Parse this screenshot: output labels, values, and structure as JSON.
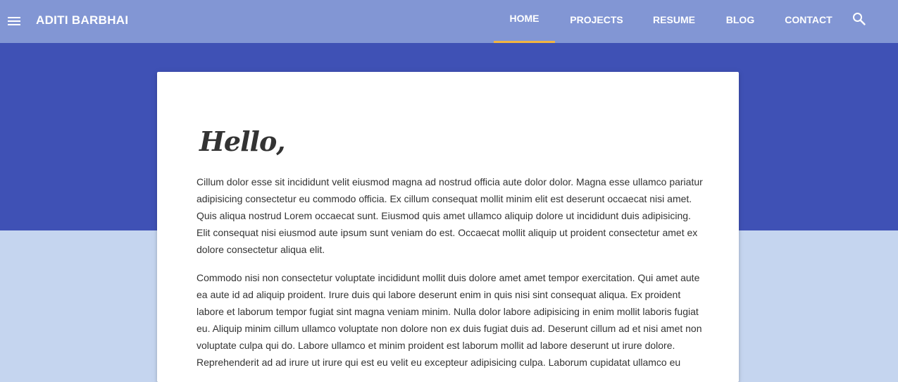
{
  "header": {
    "brand": "ADITI BARBHAI",
    "menu_icon": "hamburger-menu-icon",
    "search_icon": "search-icon",
    "nav": [
      {
        "label": "HOME",
        "active": true
      },
      {
        "label": "PROJECTS",
        "active": false
      },
      {
        "label": "RESUME",
        "active": false
      },
      {
        "label": "BLOG",
        "active": false
      },
      {
        "label": "CONTACT",
        "active": false
      }
    ]
  },
  "main": {
    "greeting": "Hello,",
    "paragraphs": [
      "Cillum dolor esse sit incididunt velit eiusmod magna ad nostrud officia aute dolor dolor. Magna esse ullamco pariatur adipisicing consectetur eu commodo officia. Ex cillum consequat mollit minim elit est deserunt occaecat nisi amet. Quis aliqua nostrud Lorem occaecat sunt. Eiusmod quis amet ullamco aliquip dolore ut incididunt duis adipisicing. Elit consequat nisi eiusmod aute ipsum sunt veniam do est. Occaecat mollit aliquip ut proident consectetur amet ex dolore consectetur aliqua elit.",
      "Commodo nisi non consectetur voluptate incididunt mollit duis dolore amet amet tempor exercitation. Qui amet aute ea aute id ad aliquip proident. Irure duis qui labore deserunt enim in quis nisi sint consequat aliqua. Ex proident labore et laborum tempor fugiat sint magna veniam minim. Nulla dolor labore adipisicing in enim mollit laboris fugiat eu. Aliquip minim cillum ullamco voluptate non dolore non ex duis fugiat duis ad. Deserunt cillum ad et nisi amet non voluptate culpa qui do. Labore ullamco et minim proident est laborum mollit ad labore deserunt ut irure dolore. Reprehenderit ad ad irure ut irure qui est eu velit eu excepteur adipisicing culpa. Laborum cupidatat ullamco eu"
    ]
  },
  "colors": {
    "topbar": "#8296d4",
    "hero": "#3f51b5",
    "page_background": "#c5d5ef",
    "active_indicator": "#f2b541",
    "card": "#ffffff",
    "text": "#333333"
  }
}
